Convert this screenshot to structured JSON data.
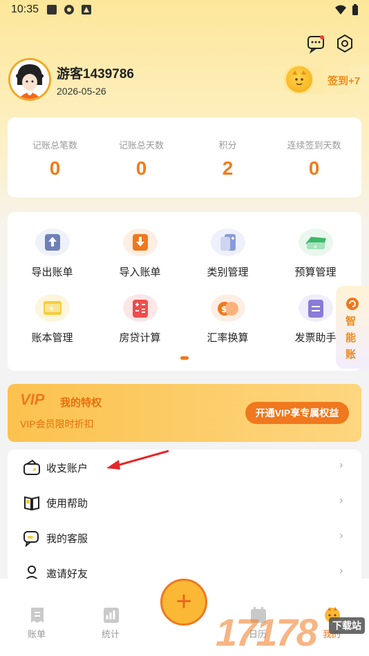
{
  "status_bar": {
    "time": "10:35"
  },
  "profile": {
    "username": "游客1439786",
    "date": "2026-05-26",
    "signin_label": "签到+7"
  },
  "stats": [
    {
      "label": "记账总笔数",
      "value": "0"
    },
    {
      "label": "记账总天数",
      "value": "0"
    },
    {
      "label": "积分",
      "value": "2"
    },
    {
      "label": "连续签到天数",
      "value": "0"
    }
  ],
  "tools": [
    {
      "label": "导出账单",
      "icon": "export-bill-icon"
    },
    {
      "label": "导入账单",
      "icon": "import-bill-icon"
    },
    {
      "label": "类别管理",
      "icon": "category-icon"
    },
    {
      "label": "预算管理",
      "icon": "budget-icon"
    },
    {
      "label": "账本管理",
      "icon": "ledger-icon"
    },
    {
      "label": "房贷计算",
      "icon": "calculator-icon"
    },
    {
      "label": "汇率换算",
      "icon": "exchange-icon"
    },
    {
      "label": "发票助手",
      "icon": "invoice-icon"
    }
  ],
  "side_tab": {
    "text": "智能账"
  },
  "vip": {
    "logo": "VIP",
    "title": "我的特权",
    "subtitle": "VIP会员限时折扣",
    "button": "开通VIP享专属权益"
  },
  "menu": [
    {
      "label": "收支账户",
      "icon": "wallet-icon"
    },
    {
      "label": "使用帮助",
      "icon": "book-icon"
    },
    {
      "label": "我的客服",
      "icon": "chat-icon"
    },
    {
      "label": "邀请好友",
      "icon": "user-icon"
    }
  ],
  "menu_chevron": "›",
  "tabbar": [
    {
      "label": "账单",
      "icon": "bill-icon"
    },
    {
      "label": "统计",
      "icon": "chart-icon"
    },
    {
      "label": "日历",
      "icon": "calendar-icon"
    },
    {
      "label": "我的",
      "icon": "profile-icon"
    }
  ],
  "fab_label": "+",
  "watermark": {
    "text": "17178",
    "badge": "下载站"
  },
  "colors": {
    "accent": "#f27c1e",
    "brand_yellow": "#fbb835"
  }
}
